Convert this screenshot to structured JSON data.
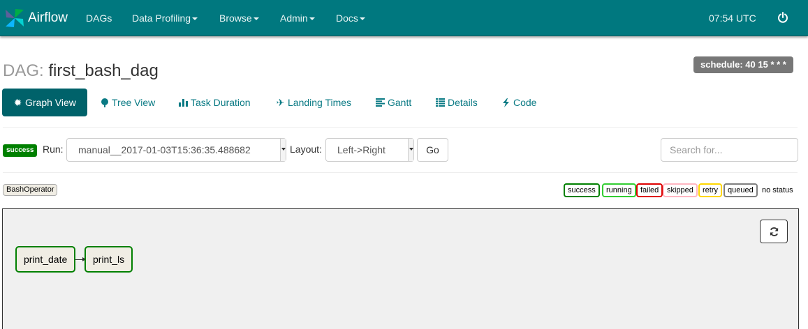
{
  "navbar": {
    "brand": "Airflow",
    "items": [
      {
        "label": "DAGs",
        "dropdown": false
      },
      {
        "label": "Data Profiling",
        "dropdown": true
      },
      {
        "label": "Browse",
        "dropdown": true
      },
      {
        "label": "Admin",
        "dropdown": true
      },
      {
        "label": "Docs",
        "dropdown": true
      }
    ],
    "time": "07:54 UTC",
    "colors": {
      "background": "#00787f"
    }
  },
  "header": {
    "prefix": "DAG:",
    "dag_id": "first_bash_dag",
    "schedule": "schedule: 40 15 * * *"
  },
  "tabs": [
    {
      "label": "Graph View",
      "icon": "gear-burst-icon",
      "active": true
    },
    {
      "label": "Tree View",
      "icon": "tree-icon",
      "active": false
    },
    {
      "label": "Task Duration",
      "icon": "bar-chart-icon",
      "active": false
    },
    {
      "label": "Landing Times",
      "icon": "plane-icon",
      "active": false
    },
    {
      "label": "Gantt",
      "icon": "align-left-icon",
      "active": false
    },
    {
      "label": "Details",
      "icon": "list-icon",
      "active": false
    },
    {
      "label": "Code",
      "icon": "flash-icon",
      "active": false
    }
  ],
  "controls": {
    "state": "success",
    "run_label": "Run:",
    "run_value": "manual__2017-01-03T15:36:35.488682",
    "layout_label": "Layout:",
    "layout_value": "Left->Right",
    "go_label": "Go",
    "search_placeholder": "Search for..."
  },
  "legend": {
    "operator": "BashOperator",
    "states": [
      {
        "label": "success",
        "color": "#008000"
      },
      {
        "label": "running",
        "color": "#32cd32"
      },
      {
        "label": "failed",
        "color": "#dd0000"
      },
      {
        "label": "skipped",
        "color": "#ffb6c1"
      },
      {
        "label": "retry",
        "color": "#ffd700"
      },
      {
        "label": "queued",
        "color": "#808080"
      },
      {
        "label": "no status",
        "color": "#ffffff"
      }
    ]
  },
  "graph": {
    "nodes": [
      {
        "label": "print_date",
        "state": "success"
      },
      {
        "label": "print_ls",
        "state": "success"
      }
    ],
    "edges": [
      [
        "print_date",
        "print_ls"
      ]
    ]
  }
}
